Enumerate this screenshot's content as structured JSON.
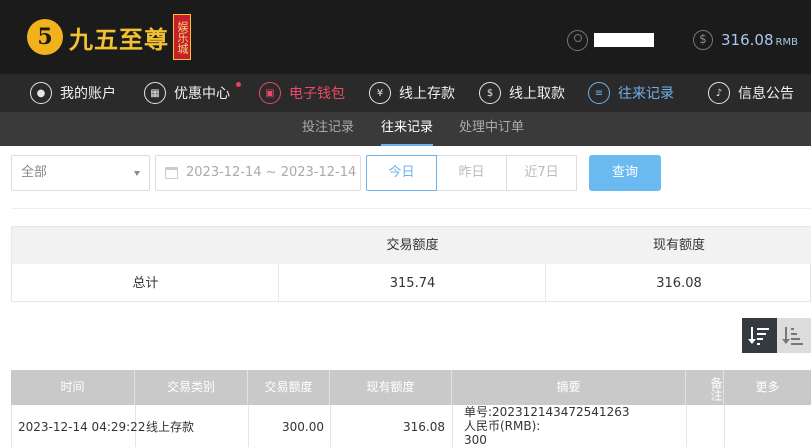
{
  "brand": {
    "logo_mark": "5",
    "name": "九五至尊",
    "badge": "娱乐城"
  },
  "header": {
    "balance_value": "316.08",
    "balance_currency": "RMB"
  },
  "nav": {
    "items": [
      {
        "label": "我的账户",
        "icon": "user-circle-icon"
      },
      {
        "label": "优惠中心",
        "icon": "gift-icon"
      },
      {
        "label": "电子钱包",
        "icon": "wallet-icon"
      },
      {
        "label": "线上存款",
        "icon": "deposit-icon"
      },
      {
        "label": "线上取款",
        "icon": "withdraw-icon"
      },
      {
        "label": "往来记录",
        "icon": "records-icon"
      },
      {
        "label": "信息公告",
        "icon": "bell-icon"
      }
    ]
  },
  "subnav": {
    "items": [
      "投注记录",
      "往来记录",
      "处理中订单"
    ]
  },
  "filters": {
    "type_selected": "全部",
    "date_range": "2023-12-14 ~ 2023-12-14",
    "range_buttons": [
      "今日",
      "昨日",
      "近7日"
    ],
    "query_label": "查询"
  },
  "summary": {
    "headers": [
      "",
      "交易额度",
      "现有额度"
    ],
    "row": [
      "总计",
      "315.74",
      "316.08"
    ]
  },
  "records": {
    "headers": [
      "时间",
      "交易类别",
      "交易额度",
      "现有额度",
      "摘要",
      "备注",
      "更多"
    ],
    "rows": [
      {
        "time": "2023-12-14 04:29:22",
        "type": "线上存款",
        "amount": "300.00",
        "balance": "316.08",
        "summary_line1": "单号:202312143472541263",
        "summary_line2": "人民币(RMB):",
        "summary_line3": "300",
        "note": "",
        "more": ""
      }
    ]
  },
  "colors": {
    "accent_blue": "#6fb1ec",
    "accent_red": "#ea4a67",
    "gold": "#f2c230",
    "header_bg": "#1b1b1b"
  }
}
